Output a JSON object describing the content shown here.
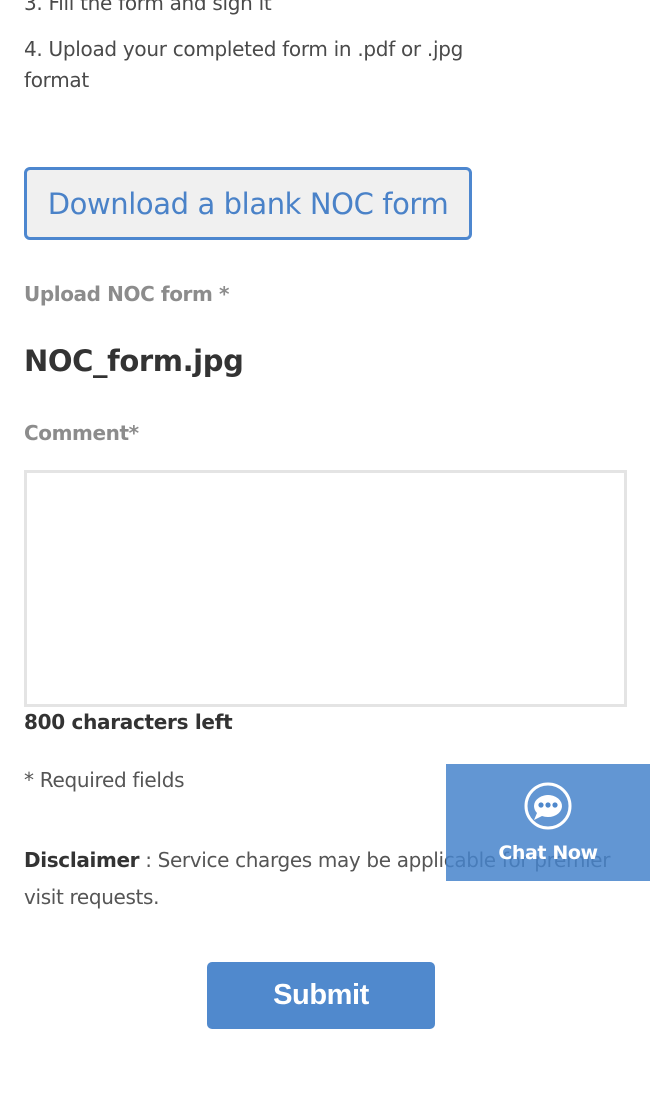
{
  "instructions": {
    "step3": "3. Fill the form and sign it",
    "step4": "4. Upload your completed form in .pdf or .jpg format"
  },
  "download_button": {
    "label": "Download a blank NOC form"
  },
  "upload": {
    "label": "Upload NOC form *",
    "filename": "NOC_form.jpg"
  },
  "comment": {
    "label": "Comment*",
    "value": "",
    "chars_left": "800 characters left"
  },
  "required_note": "* Required fields",
  "disclaimer": {
    "title": "Disclaimer",
    "separator": " : ",
    "text": "Service charges may be applicable for premier visit requests."
  },
  "chat": {
    "label": "Chat Now",
    "icon": "chat-bubble-icon"
  },
  "submit": {
    "label": "Submit"
  },
  "colors": {
    "accent": "#4d87cf",
    "submit_bg": "#5089cd",
    "chat_bg": "#4784cb"
  }
}
